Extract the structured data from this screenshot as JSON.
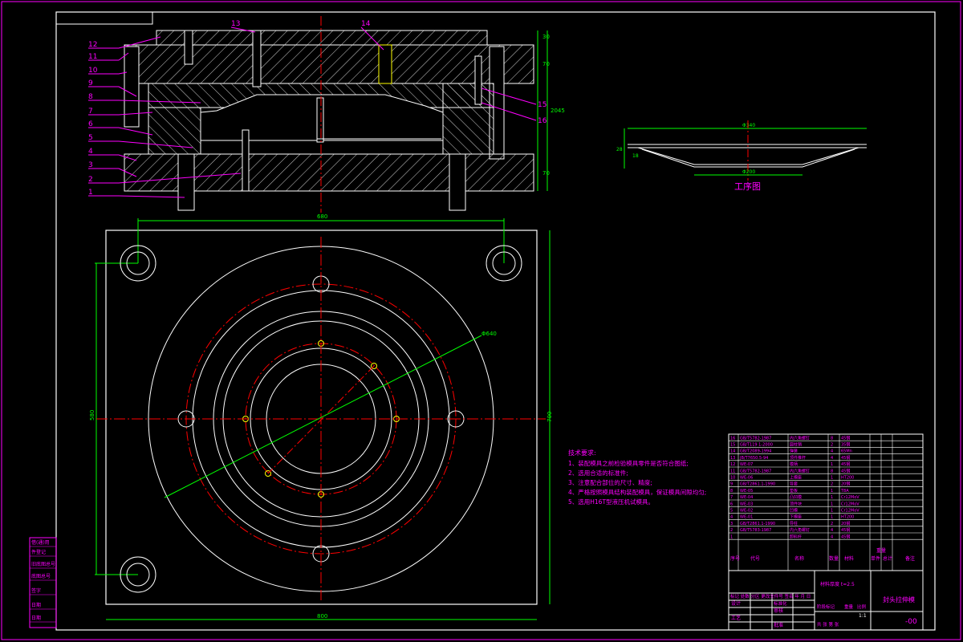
{
  "colors": {
    "background": "#000000",
    "frame": "#ff00ff",
    "outline": "#ffffff",
    "centerline": "#ff0000",
    "dimension": "#00ff00",
    "hatch": "#ffffff",
    "accent": "#ffff00"
  },
  "callouts_left": [
    "12",
    "11",
    "10",
    "9",
    "8",
    "7",
    "6",
    "5",
    "4",
    "3",
    "2",
    "1"
  ],
  "callouts_top": [
    "13",
    "14"
  ],
  "callouts_right": [
    "15",
    "16"
  ],
  "section_dims": {
    "top": "30",
    "mid": "70",
    "total": "2045",
    "bottom": "70"
  },
  "process_drawing": {
    "title": "工序图",
    "dim_top": "Φ340",
    "dim_bottom": "Φ200",
    "dim_h1": "28",
    "dim_h2": "18"
  },
  "plan_dims": {
    "width_top": "680",
    "width_bottom": "800",
    "height_left": "580",
    "height_right": "700",
    "diameter": "Φ640"
  },
  "tech_req": {
    "title": "技术要求:",
    "items": [
      "1、装配模具之前检验模具零件是否符合图纸;",
      "2、选用合适的标准件;",
      "3、注意配合部位的尺寸、精度;",
      "4、严格按照模具结构装配模具，保证模具间隙均匀;",
      "5、选用H16T型液压机试模具。"
    ]
  },
  "bom": {
    "rows": [
      [
        "16",
        "GB/T5782-1987",
        "内六角螺钉",
        "8",
        "45钢"
      ],
      [
        "15",
        "GB/T119 1-2000",
        "圆柱销",
        "2",
        "35钢"
      ],
      [
        "14",
        "GB/T2089-1994",
        "弹簧",
        "4",
        "65Mn"
      ],
      [
        "13",
        "JB/T7650.5-94",
        "顶件推杆",
        "4",
        "45钢"
      ],
      [
        "12",
        "WE-07",
        "模柄",
        "1",
        "45钢"
      ],
      [
        "11",
        "GB/T5782-1987",
        "内六角螺钉",
        "8",
        "45钢"
      ],
      [
        "10",
        "WE-06",
        "上模座",
        "1",
        "HT200"
      ],
      [
        "9",
        "GB/T2861.1-1990",
        "导套",
        "2",
        "20钢"
      ],
      [
        "8",
        "WE-05",
        "垫板",
        "1",
        "T8A"
      ],
      [
        "7",
        "WE-04",
        "凸凹模",
        "1",
        "Cr12MoV"
      ],
      [
        "6",
        "WE-03",
        "顶件块",
        "1",
        "Cr12MoV"
      ],
      [
        "5",
        "WE-02",
        "凹模",
        "1",
        "Cr12MoV"
      ],
      [
        "4",
        "WE-01",
        "下模座",
        "1",
        "HT200"
      ],
      [
        "3",
        "GB/T2861.1-1990",
        "导柱",
        "2",
        "20钢"
      ],
      [
        "2",
        "GB/T5783-1987",
        "内六角螺钉",
        "4",
        "45钢"
      ],
      [
        "1",
        "",
        "卸料杆",
        "4",
        "45钢"
      ]
    ],
    "header": [
      "序号",
      "代号",
      "名称",
      "数量",
      "材料",
      "单件",
      "总计",
      "备注"
    ],
    "header_weight": "重量"
  },
  "title_block": {
    "scale_note": "材料厚度 t=2.5",
    "part_name": "封头拉伸模",
    "drawing_no": "-00",
    "revision_row": "标记 处数 分区 更改文件号 签名 年 月 日",
    "design": "设计",
    "standard": "标准化",
    "review": "审核",
    "process": "工艺",
    "approve": "批准",
    "stage": "阶段标记",
    "weight": "重量",
    "scale_label": "比例",
    "scale": "1:1",
    "sheet": "共 张 第 张"
  },
  "side_stamp": [
    "借(通)用",
    "件登记",
    "旧底图总号",
    "底图总号",
    "签字",
    "日期",
    "日期"
  ]
}
